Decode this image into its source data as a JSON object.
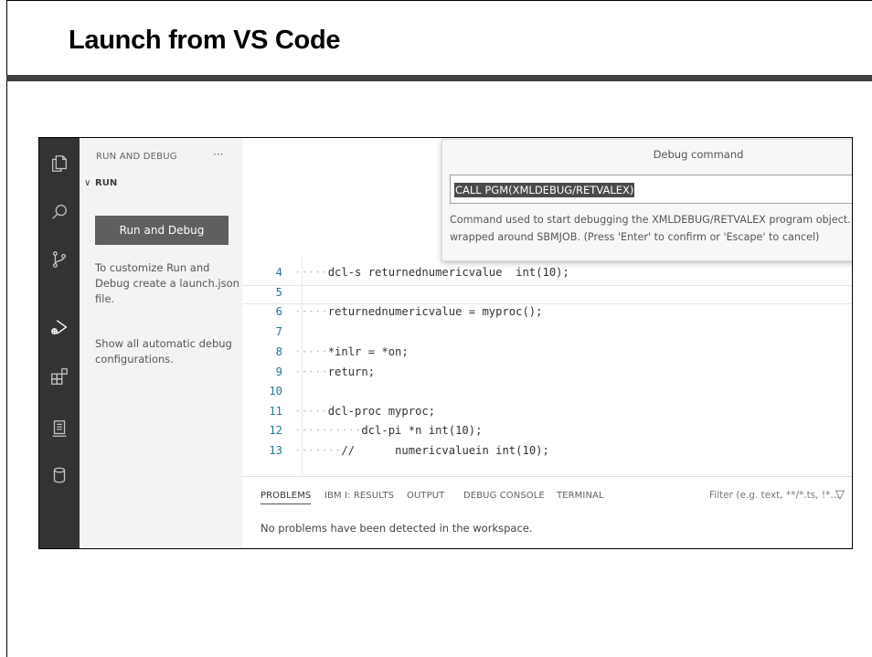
{
  "slide": {
    "title": "Launch from VS Code"
  },
  "activity_bar": {
    "icons": [
      "explorer-icon",
      "search-icon",
      "source-control-icon",
      "run-debug-icon",
      "extensions-icon",
      "ibmi-icon",
      "database-icon"
    ]
  },
  "sidebar": {
    "header": "RUN AND DEBUG",
    "more": "···",
    "section": "RUN",
    "run_button": "Run and Debug",
    "customize_text": "To customize Run and Debug create a launch.json file.",
    "show_all_text": "Show all automatic debug configurations."
  },
  "debug_popup": {
    "title": "Debug command",
    "input_value": "CALL PGM(XMLDEBUG/RETVALEX)",
    "description": "Command used to start debugging the XMLDEBUG/RETVALEX program object. The command is wrapped around SBMJOB. (Press 'Enter' to confirm or 'Escape' to cancel)"
  },
  "code_lines": [
    {
      "no": "4",
      "text": "dcl-s returnednumericvalue  int(10);"
    },
    {
      "no": "5",
      "text": ""
    },
    {
      "no": "6",
      "text": "returnednumericvalue = myproc();"
    },
    {
      "no": "7",
      "text": ""
    },
    {
      "no": "8",
      "text": "*inlr = *on;"
    },
    {
      "no": "9",
      "text": "return;"
    },
    {
      "no": "10",
      "text": ""
    },
    {
      "no": "11",
      "text": "dcl-proc myproc;"
    },
    {
      "no": "12",
      "text": "dcl-pi *n int(10);"
    },
    {
      "no": "13",
      "text": "//      numericvaluein int(10);"
    }
  ],
  "panel": {
    "tabs": [
      "PROBLEMS",
      "IBM I: RESULTS",
      "OUTPUT",
      "DEBUG CONSOLE",
      "TERMINAL"
    ],
    "active_tab": "PROBLEMS",
    "filter_placeholder": "Filter (e.g. text, **/*.ts, !*...",
    "message": "No problems have been detected in the workspace."
  }
}
